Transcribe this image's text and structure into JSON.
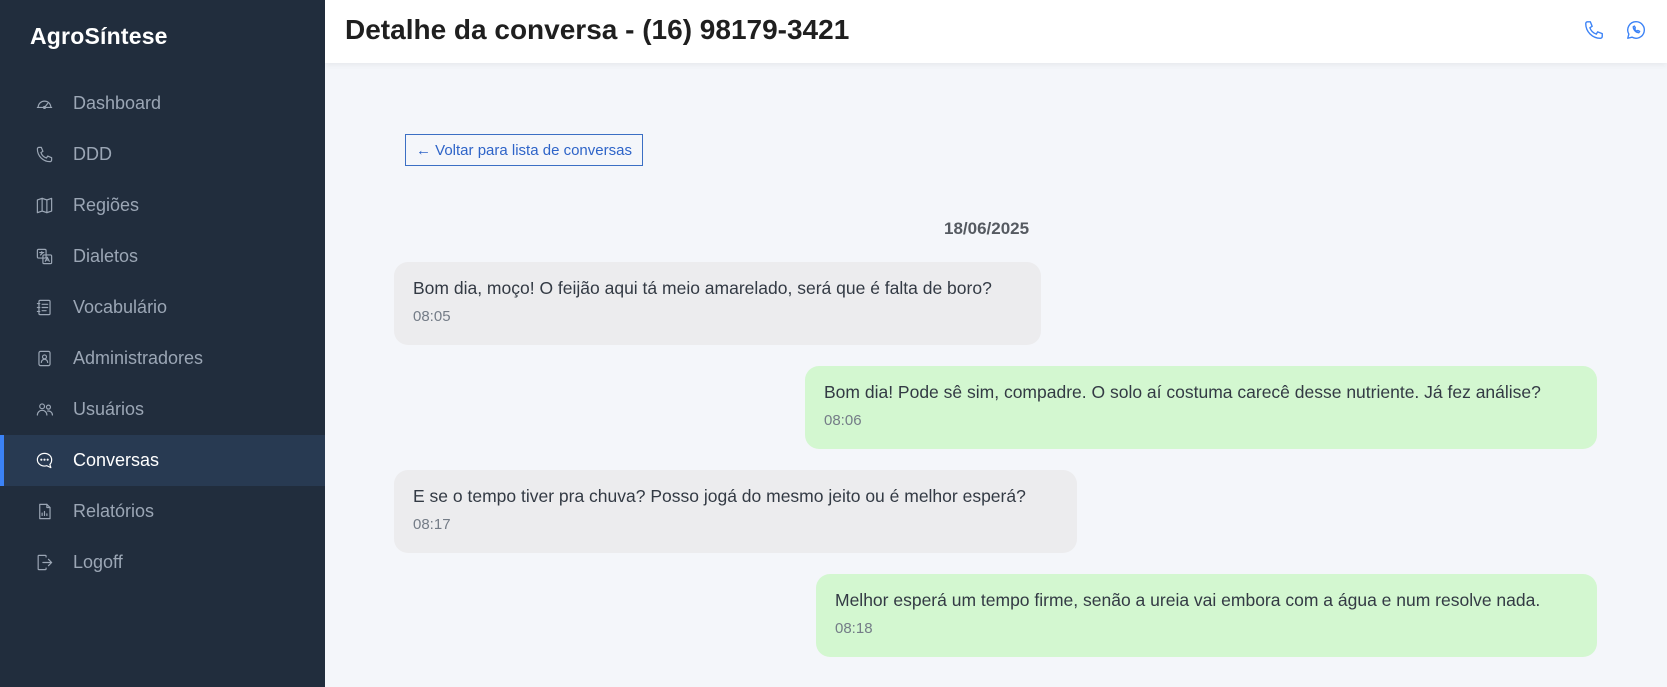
{
  "app": {
    "brand": "AgroSíntese"
  },
  "sidebar": {
    "items": [
      {
        "label": "Dashboard",
        "icon": "gauge-icon"
      },
      {
        "label": "DDD",
        "icon": "phone-icon"
      },
      {
        "label": "Regiões",
        "icon": "map-icon"
      },
      {
        "label": "Dialetos",
        "icon": "translate-icon"
      },
      {
        "label": "Vocabulário",
        "icon": "book-icon"
      },
      {
        "label": "Administradores",
        "icon": "badge-icon"
      },
      {
        "label": "Usuários",
        "icon": "users-icon"
      },
      {
        "label": "Conversas",
        "icon": "chat-icon",
        "active": true
      },
      {
        "label": "Relatórios",
        "icon": "report-icon"
      },
      {
        "label": "Logoff",
        "icon": "logout-icon"
      }
    ]
  },
  "header": {
    "title": "Detalhe da conversa - (16) 98179-3421",
    "actions": [
      {
        "icon": "phone-icon"
      },
      {
        "icon": "whatsapp-icon"
      }
    ]
  },
  "main": {
    "back_label": "← Voltar para lista de conversas",
    "date": "18/06/2025",
    "messages": [
      {
        "direction": "in",
        "text": "Bom dia, moço! O feijão aqui tá meio amarelado, será que é falta de boro?",
        "time": "08:05"
      },
      {
        "direction": "out",
        "text": "Bom dia! Pode sê sim, compadre. O solo aí costuma carecê desse nutriente. Já fez análise?",
        "time": "08:06"
      },
      {
        "direction": "in",
        "text": "E se o tempo tiver pra chuva? Posso jogá do mesmo jeito ou é melhor esperá?",
        "time": "08:17"
      },
      {
        "direction": "out",
        "text": "Melhor esperá um tempo firme, senão a ureia vai embora com a água e num resolve nada.",
        "time": "08:18"
      }
    ]
  },
  "colors": {
    "sidebar_bg": "#212d3d",
    "active_accent": "#3b82f6",
    "incoming_bubble": "#ececee",
    "outgoing_bubble": "#d3f7d0",
    "link": "#2e64c8"
  }
}
